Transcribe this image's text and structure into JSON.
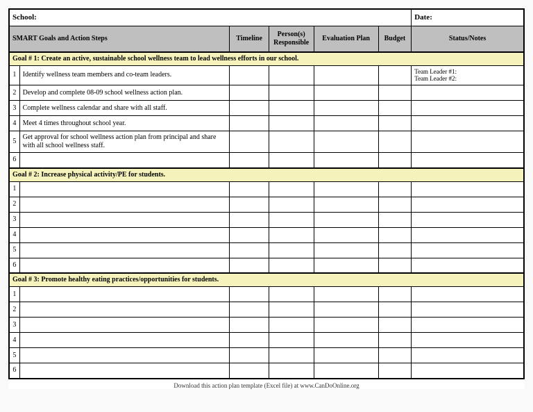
{
  "top": {
    "school_label": "School:",
    "date_label": "Date:"
  },
  "headers": {
    "goals": "SMART Goals and Action Steps",
    "timeline": "Timeline",
    "persons": "Person(s) Responsible",
    "eval": "Evaluation Plan",
    "budget": "Budget",
    "notes": "Status/Notes"
  },
  "goals": [
    {
      "title": "Goal # 1: Create an active, sustainable school wellness team to lead wellness efforts in our school.",
      "steps": [
        {
          "n": "1",
          "text": "Identify wellness team members and co-team leaders.",
          "notes": "Team Leader #1:\nTeam Leader #2:"
        },
        {
          "n": "2",
          "text": "Develop and complete 08-09 school wellness action plan.",
          "notes": ""
        },
        {
          "n": "3",
          "text": "Complete wellness calendar and share with all staff.",
          "notes": ""
        },
        {
          "n": "4",
          "text": "Meet 4 times throughout school year.",
          "notes": ""
        },
        {
          "n": "5",
          "text": "Get approval for school wellness action plan from principal and share with all school wellness staff.",
          "notes": ""
        },
        {
          "n": "6",
          "text": "",
          "notes": ""
        }
      ]
    },
    {
      "title": "Goal # 2: Increase physical activity/PE for students.",
      "steps": [
        {
          "n": "1",
          "text": "",
          "notes": ""
        },
        {
          "n": "2",
          "text": "",
          "notes": ""
        },
        {
          "n": "3",
          "text": "",
          "notes": ""
        },
        {
          "n": "4",
          "text": "",
          "notes": ""
        },
        {
          "n": "5",
          "text": "",
          "notes": ""
        },
        {
          "n": "6",
          "text": "",
          "notes": ""
        }
      ]
    },
    {
      "title": "Goal # 3: Promote healthy eating practices/opportunities for students.",
      "steps": [
        {
          "n": "1",
          "text": "",
          "notes": ""
        },
        {
          "n": "2",
          "text": "",
          "notes": ""
        },
        {
          "n": "3",
          "text": "",
          "notes": ""
        },
        {
          "n": "4",
          "text": "",
          "notes": ""
        },
        {
          "n": "5",
          "text": "",
          "notes": ""
        },
        {
          "n": "6",
          "text": "",
          "notes": ""
        }
      ]
    }
  ],
  "footer": "Download this action plan template (Excel file) at www.CanDoOnline.org"
}
